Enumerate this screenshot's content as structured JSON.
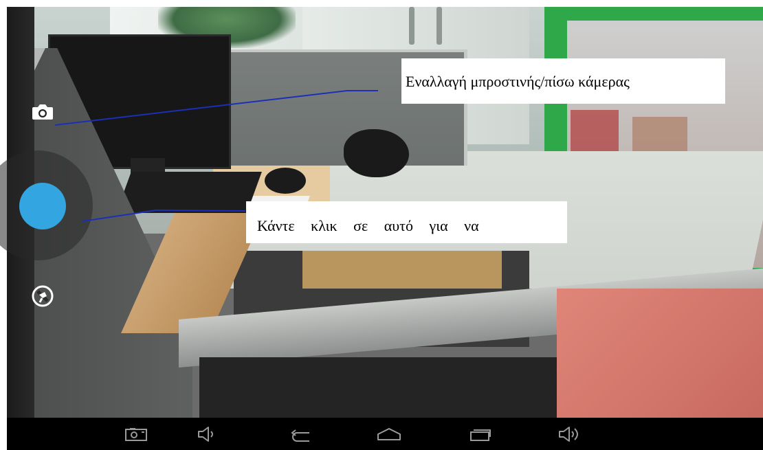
{
  "viewfinder": {
    "controls": {
      "switch_camera_icon": "camera-icon",
      "shutter_color": "#33a5e0",
      "settings_icon": "settings-icon"
    }
  },
  "annotations": {
    "switch_camera_label": "Εναλλαγή μπροστινής/πίσω κάμερας",
    "shutter_label": "Κάντε κλικ σε αυτό για να",
    "line_color": "#1b2fb8"
  },
  "navbar": {
    "buttons": [
      {
        "name": "screenshot",
        "icon": "screenshot-icon"
      },
      {
        "name": "volume-down",
        "icon": "volume-down-icon"
      },
      {
        "name": "back",
        "icon": "back-icon"
      },
      {
        "name": "home",
        "icon": "home-icon"
      },
      {
        "name": "recent-apps",
        "icon": "recent-apps-icon"
      },
      {
        "name": "volume-up",
        "icon": "volume-up-icon"
      }
    ]
  }
}
